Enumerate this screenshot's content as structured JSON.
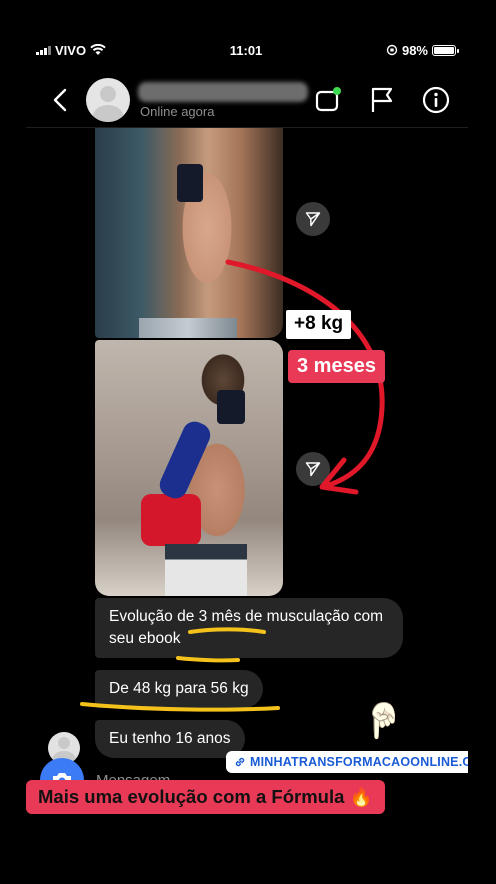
{
  "status_bar": {
    "carrier": "VIVO",
    "time": "11:01",
    "battery": "98%"
  },
  "header": {
    "presence": "Online agora",
    "icons": [
      "back-chevron-icon",
      "video-chat-icon",
      "flag-icon",
      "info-icon"
    ]
  },
  "annotations": {
    "weight_tag": "+8 kg",
    "duration_tag": "3 meses"
  },
  "messages": [
    {
      "text": "Evolução de 3 mês de musculação com seu ebook"
    },
    {
      "text": "De 48 kg para 56 kg"
    },
    {
      "text": "Eu tenho 16 anos"
    }
  ],
  "link_sticker": {
    "text": "MINHATRANSFORMACAOONLINE.COM"
  },
  "composer": {
    "placeholder": "Mensagem..."
  },
  "caption": {
    "text": "Mais uma evolução com a Fórmula 🔥"
  },
  "colors": {
    "accent_pink": "#e83a56",
    "arrow_red": "#e0182a",
    "underline_yellow": "#f4c21a",
    "camera_blue": "#3b7bf5",
    "bubble_gray": "#262626"
  }
}
